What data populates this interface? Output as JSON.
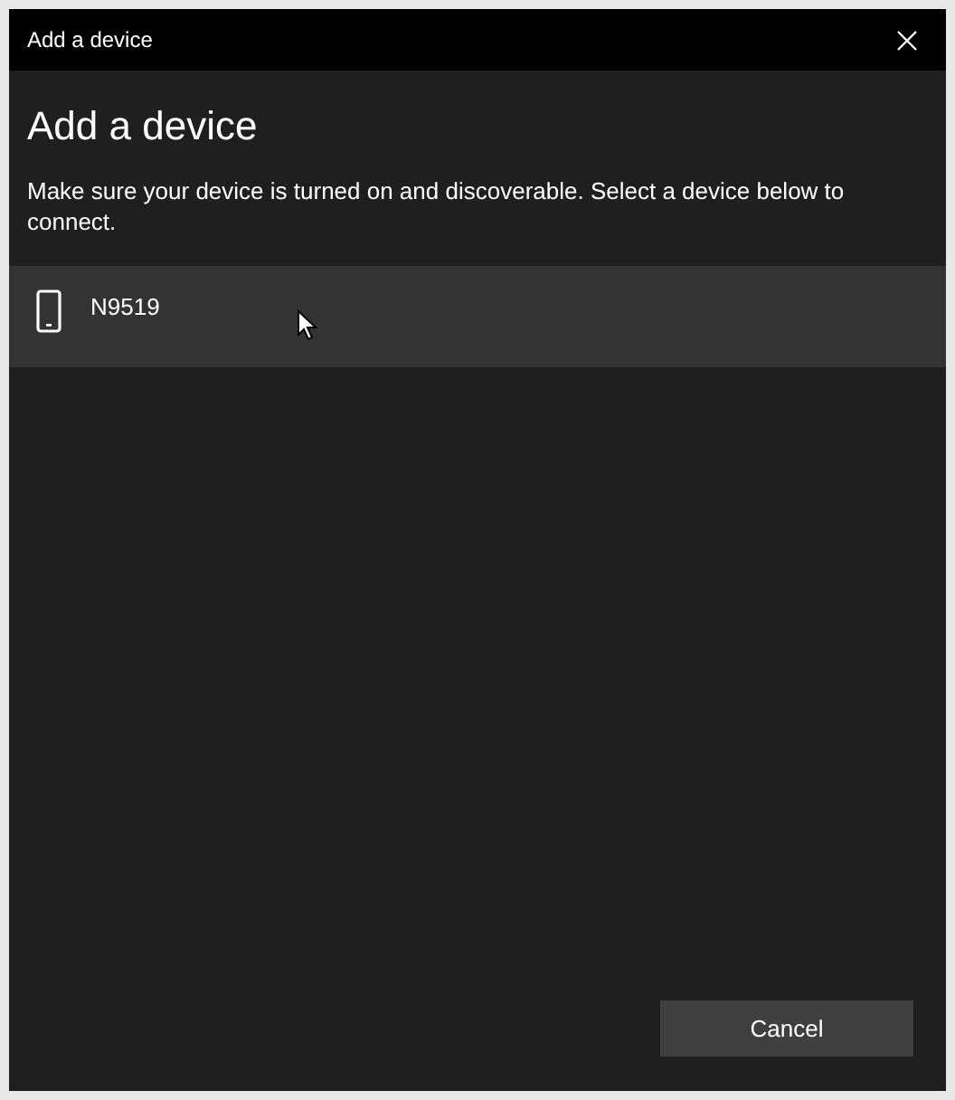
{
  "window": {
    "title": "Add a device"
  },
  "heading": "Add a device",
  "description": "Make sure your device is turned on and discoverable. Select a device below to connect.",
  "devices": [
    {
      "name": "N9519",
      "kind": "phone",
      "highlighted": true
    }
  ],
  "buttons": [
    "Cancel"
  ]
}
